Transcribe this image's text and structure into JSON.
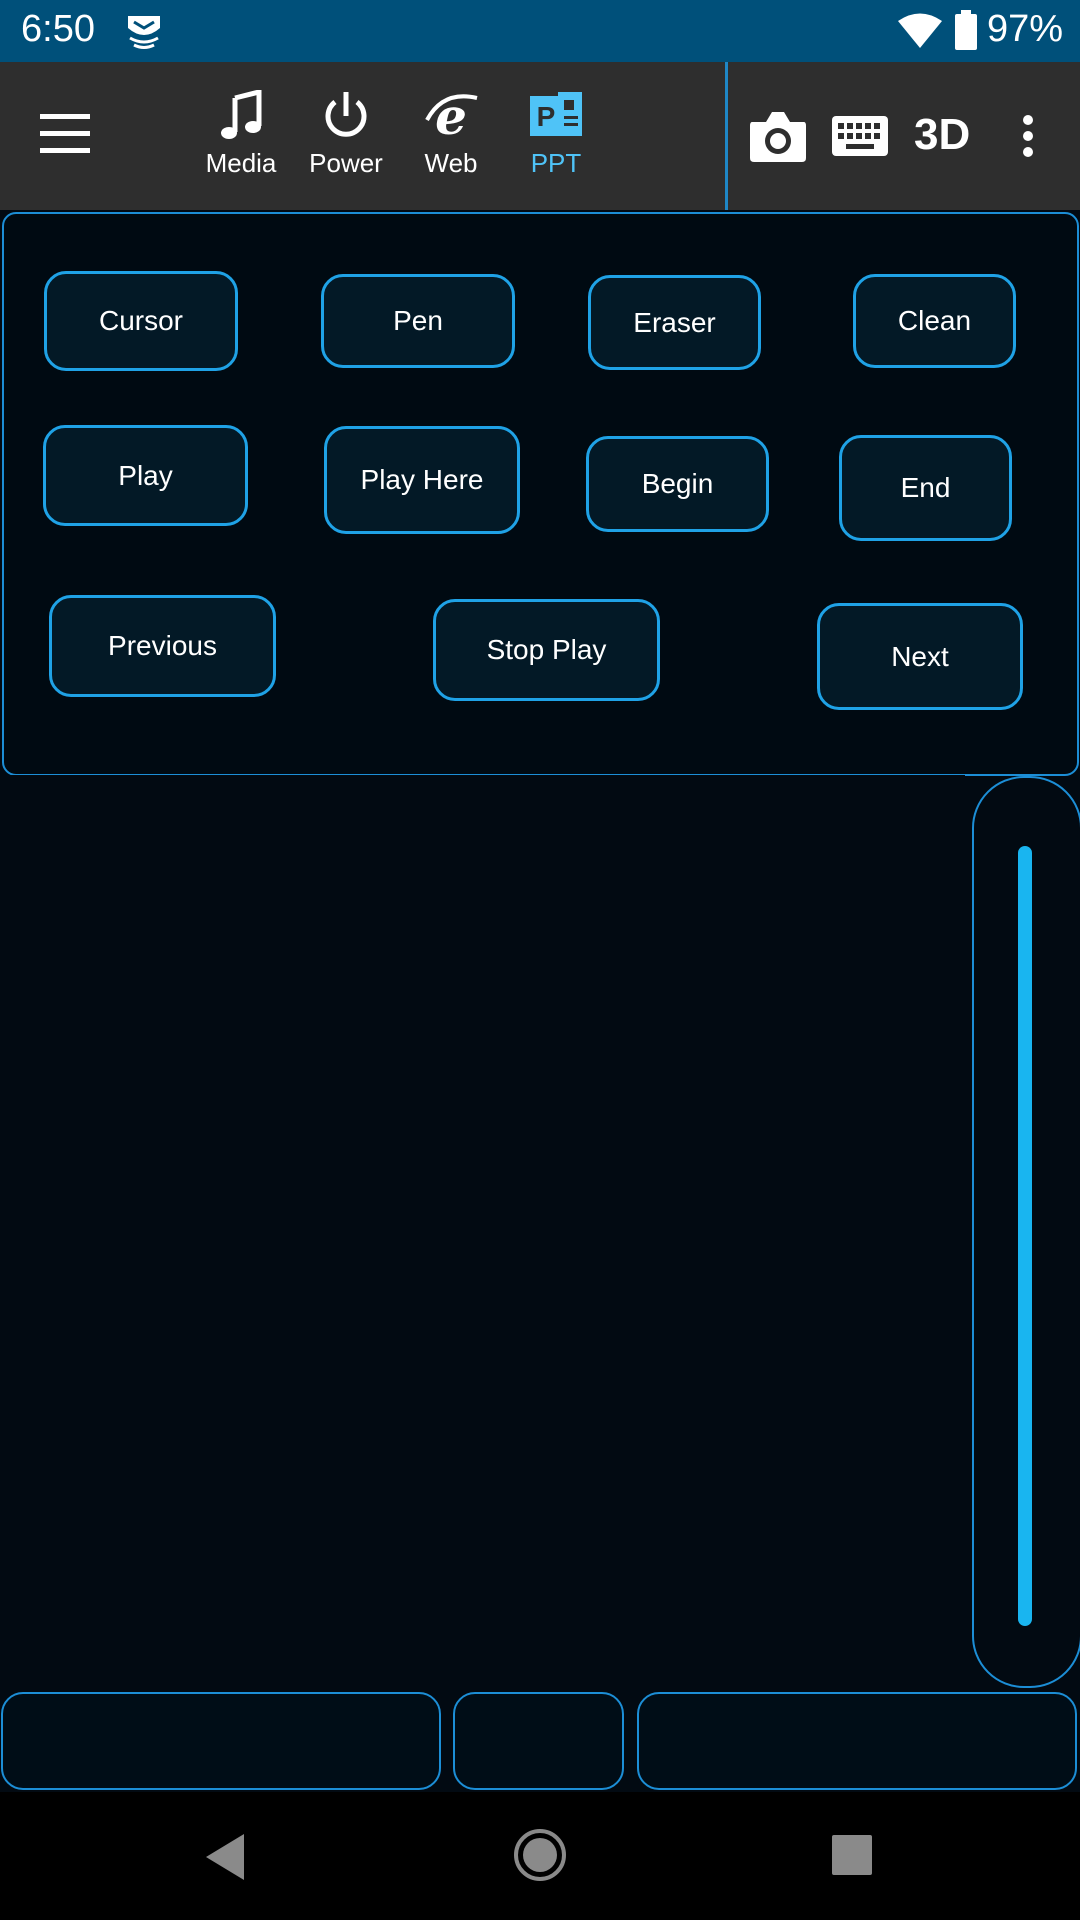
{
  "status_bar": {
    "time": "6:50",
    "battery_percent": "97%",
    "icons": [
      "notification-app-icon",
      "wifi-icon",
      "battery-icon"
    ]
  },
  "toolbar": {
    "menu_icon": "hamburger-menu-icon",
    "tabs": [
      {
        "label": "Media",
        "icon": "music-note-icon",
        "active": false
      },
      {
        "label": "Power",
        "icon": "power-icon",
        "active": false
      },
      {
        "label": "Web",
        "icon": "internet-explorer-icon",
        "active": false
      },
      {
        "label": "PPT",
        "icon": "powerpoint-icon",
        "active": true
      }
    ],
    "camera_icon": "camera-icon",
    "keyboard_icon": "keyboard-icon",
    "mode_3d_label": "3D",
    "overflow_icon": "more-vert-icon"
  },
  "ppt_panel": {
    "buttons": [
      "Cursor",
      "Pen",
      "Eraser",
      "Clean",
      "Play",
      "Play Here",
      "Begin",
      "End",
      "Previous",
      "Stop Play",
      "Next"
    ]
  },
  "colors": {
    "status_bar": "#00507a",
    "toolbar": "#2e2e2e",
    "accent": "#1fa2e6",
    "active_tab": "#4fc3f7",
    "scroll_bar": "#19b5f0",
    "background": "#020a12"
  },
  "nav_bar": {
    "icons": [
      "back-icon",
      "home-icon",
      "recents-icon"
    ]
  }
}
